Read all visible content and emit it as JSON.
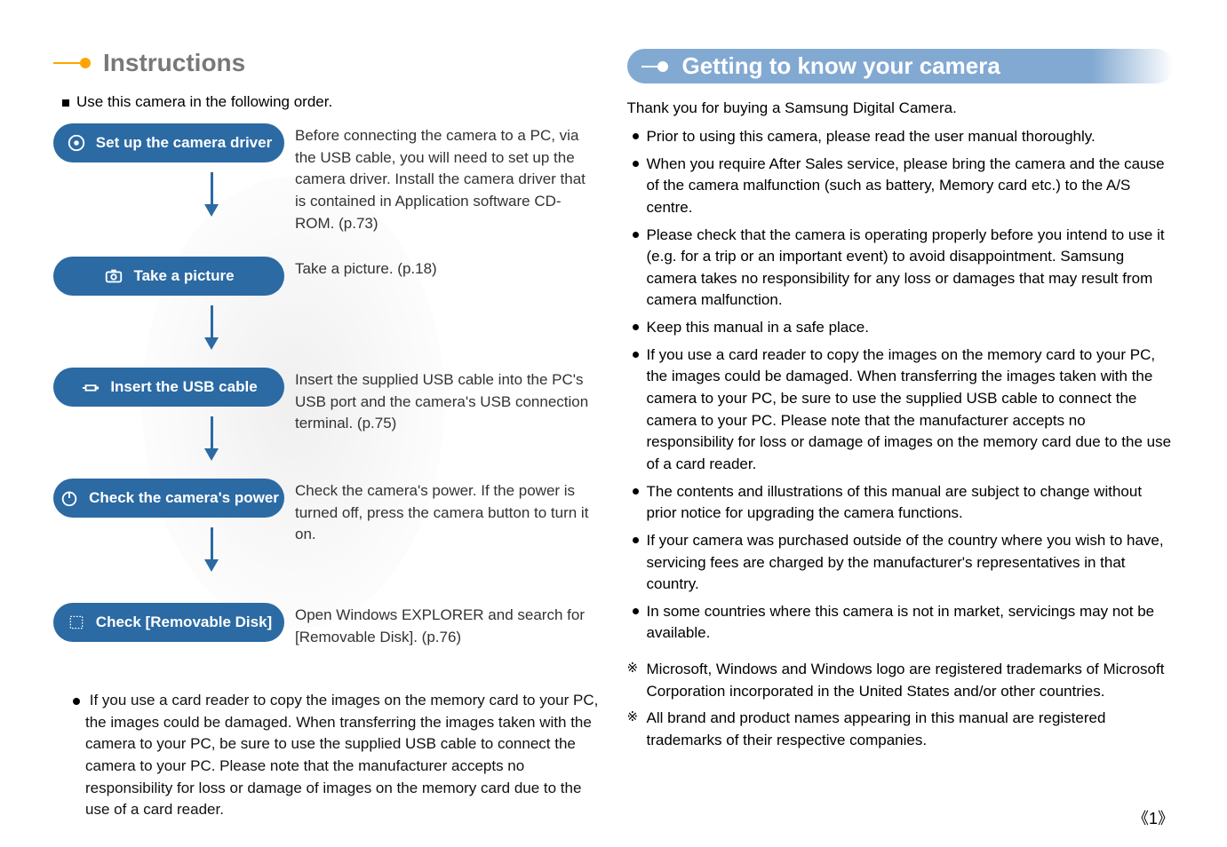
{
  "left": {
    "title": "Instructions",
    "intro_bulleted": "Use this camera in the following order.",
    "steps": [
      {
        "icon": "cd-icon",
        "pill": "Set up the camera driver",
        "desc": "Before connecting the camera to a PC, via the USB cable, you will need to set up the camera driver. Install the camera driver that is contained in Application software CD-ROM. (p.73)"
      },
      {
        "icon": "camera-icon",
        "pill": "Take a picture",
        "desc": "Take a picture. (p.18)"
      },
      {
        "icon": "usb-icon",
        "pill": "Insert the USB cable",
        "desc": "Insert the supplied USB cable into the PC's USB port and the camera's USB connection terminal. (p.75)"
      },
      {
        "icon": "power-icon",
        "pill": "Check the camera's power",
        "desc": "Check the camera's power. If the power is turned off, press the camera button to turn it on."
      },
      {
        "icon": "disk-icon",
        "pill": "Check [Removable Disk]",
        "desc": "Open Windows EXPLORER and search for [Removable Disk]. (p.76)"
      }
    ],
    "footnote": "If you use a card reader to copy the images on the memory card to your PC, the images could be damaged. When transferring the images taken with the camera to your PC, be sure to use the supplied USB cable to connect the camera to your PC. Please note that the manufacturer accepts no responsibility for loss or damage of images on the memory card due to the use of a card reader."
  },
  "right": {
    "title": "Getting to know your camera",
    "thanks": "Thank you for buying a Samsung Digital Camera.",
    "bullets": [
      "Prior to using this camera, please read the user manual thoroughly.",
      "When you require After Sales service, please bring the camera and the cause of the camera malfunction (such as battery, Memory card etc.) to the A/S centre.",
      "Please check that the camera is operating properly before you intend to use it (e.g. for a trip or an important event) to avoid disappointment. Samsung camera takes no responsibility for any loss or damages that may result from camera malfunction.",
      "Keep this manual in a safe place.",
      "If you use a card reader to copy the images on the memory card to your PC, the images could be damaged. When transferring the images taken with the camera to your PC, be sure to use the supplied USB cable to connect the camera to your PC. Please note that the manufacturer accepts no responsibility for loss or damage of images on the memory card due to the use of a card reader.",
      "The contents and illustrations of this manual are subject to change without prior notice for upgrading the camera functions.",
      "If your camera was purchased outside of the country where you wish to have, servicing fees are charged by the manufacturer's representatives in that country.",
      "In some countries where this camera is not in market, servicings may not be available."
    ],
    "asterisks": [
      "Microsoft, Windows and Windows logo are registered trademarks of Microsoft Corporation incorporated in the United States and/or other countries.",
      "All brand and product names appearing in this manual are registered trademarks of their respective companies."
    ]
  },
  "page_number": "《1》"
}
